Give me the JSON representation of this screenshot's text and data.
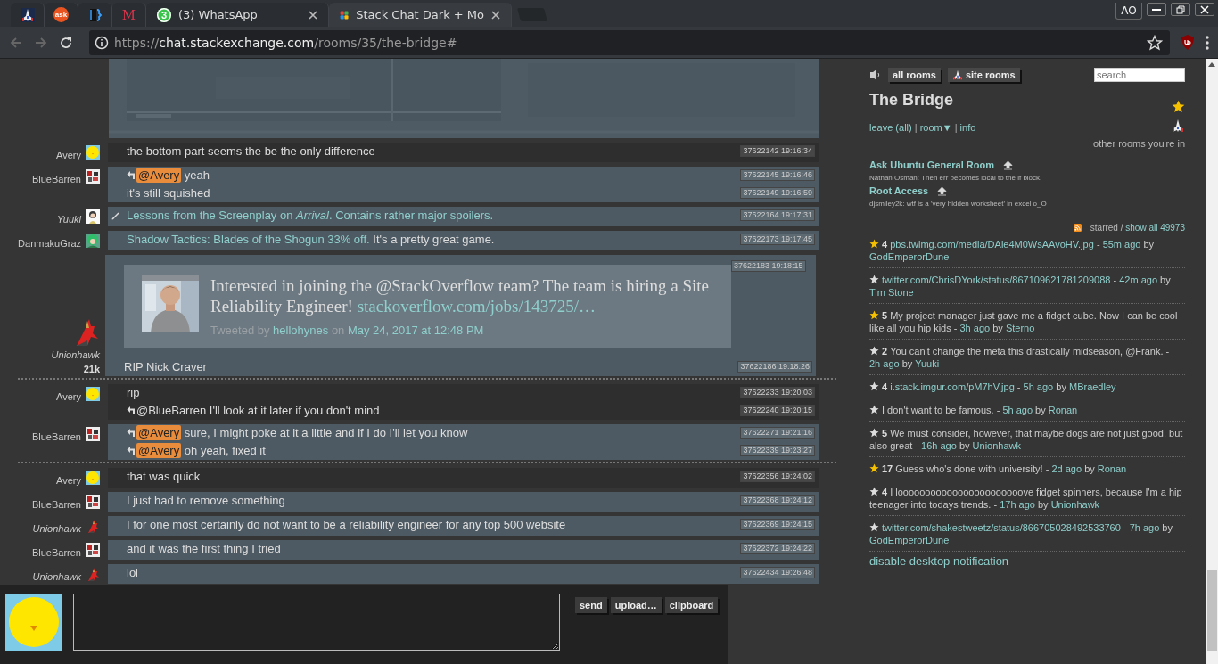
{
  "browser": {
    "tabs": [
      {
        "kind": "ship",
        "selected": false
      },
      {
        "kind": "badge",
        "label": "ask",
        "selected": false
      },
      {
        "kind": "brackets",
        "selected": false
      },
      {
        "kind": "letter",
        "label": "M",
        "selected": false
      },
      {
        "kind": "whatsapp",
        "badge": "3",
        "title": "(3) WhatsApp",
        "selected": false
      },
      {
        "kind": "squares",
        "title": "Stack Chat Dark + Mo",
        "selected": true
      }
    ],
    "profile": "AO",
    "url": [
      {
        "kind": "dim",
        "text": "https://"
      },
      {
        "kind": "host",
        "text": "chat.stackexchange.com"
      },
      {
        "kind": "dim",
        "text": "/rooms/35/the-bridge#"
      }
    ]
  },
  "chat": {
    "groups": [
      {
        "user": {
          "name": "Avery",
          "owner": false,
          "kind": "chick"
        },
        "mine": true,
        "separator_before": false,
        "messages": [
          {
            "reply": false,
            "edited": false,
            "parts": [
              {
                "kind": "text",
                "text": "the bottom part seems the be the only difference"
              }
            ],
            "meta": "37622142 19:16:34"
          }
        ]
      },
      {
        "user": {
          "name": "BlueBarren",
          "owner": false,
          "kind": "pixel"
        },
        "mine": false,
        "separator_before": false,
        "messages": [
          {
            "reply": true,
            "edited": false,
            "parts": [
              {
                "kind": "mention",
                "text": "@Avery"
              },
              {
                "kind": "text",
                "text": " yeah"
              }
            ],
            "meta": "37622145 19:16:46"
          },
          {
            "reply": false,
            "edited": false,
            "parts": [
              {
                "kind": "text",
                "text": "it's still squished"
              }
            ],
            "meta": "37622149 19:16:59"
          }
        ]
      },
      {
        "user": {
          "name": "Yuuki",
          "owner": true,
          "kind": "girl"
        },
        "mine": false,
        "separator_before": false,
        "messages": [
          {
            "reply": false,
            "edited": true,
            "parts": [
              {
                "kind": "link",
                "text": "Lessons from the Screenplay on *Arrival*. Contains rather major spoilers."
              }
            ],
            "meta": "37622164 19:17:31"
          }
        ]
      },
      {
        "user": {
          "name": "DanmakuGraz",
          "owner": false,
          "kind": "green"
        },
        "mine": false,
        "separator_before": false,
        "messages": [
          {
            "reply": false,
            "edited": false,
            "parts": [
              {
                "kind": "link",
                "text": "Shadow Tactics: Blades of the Shogun 33% off."
              },
              {
                "kind": "text",
                "text": " It's a pretty great game."
              }
            ],
            "meta": "37622173 19:17:45"
          }
        ]
      },
      {
        "user": {
          "name": "Unionhawk",
          "owner": true,
          "kind": "dragon",
          "rep": "21k"
        },
        "mine": false,
        "separator_before": false,
        "messages": [
          {
            "reply": false,
            "edited": false,
            "onebox": {
              "parts": [
                {
                  "kind": "text",
                  "text": "Interested in joining the @StackOverflow team? The team is hiring a Site Reliability Engineer! "
                },
                {
                  "kind": "link",
                  "text": "stackoverflow.com/jobs/143725/…"
                }
              ],
              "byline": [
                {
                  "kind": "text",
                  "text": "Tweeted by "
                },
                {
                  "kind": "link",
                  "text": "hellohynes"
                },
                {
                  "kind": "text",
                  "text": " on "
                },
                {
                  "kind": "link",
                  "text": "May 24, 2017 at 12:48 PM"
                }
              ]
            },
            "meta": "37622183 19:18:15"
          },
          {
            "reply": false,
            "edited": false,
            "parts": [
              {
                "kind": "text",
                "text": "RIP Nick Craver"
              }
            ],
            "meta": "37622186 19:18:26"
          }
        ]
      },
      {
        "user": {
          "name": "Avery",
          "owner": false,
          "kind": "chick"
        },
        "mine": true,
        "separator_before": true,
        "messages": [
          {
            "reply": false,
            "edited": false,
            "parts": [
              {
                "kind": "text",
                "text": "rip"
              }
            ],
            "meta": "37622233 19:20:03"
          },
          {
            "reply": true,
            "edited": false,
            "parts": [
              {
                "kind": "text",
                "text": "@BlueBarren I'll look at it later if you don't mind"
              }
            ],
            "meta": "37622240 19:20:15"
          }
        ]
      },
      {
        "user": {
          "name": "BlueBarren",
          "owner": false,
          "kind": "pixel"
        },
        "mine": false,
        "separator_before": false,
        "messages": [
          {
            "reply": true,
            "edited": false,
            "parts": [
              {
                "kind": "mention",
                "text": "@Avery"
              },
              {
                "kind": "text",
                "text": " sure, I might poke at it a little and if I do I'll let you know"
              }
            ],
            "meta": "37622271 19:21:16"
          },
          {
            "reply": true,
            "edited": false,
            "parts": [
              {
                "kind": "mention",
                "text": "@Avery"
              },
              {
                "kind": "text",
                "text": " oh yeah, fixed it"
              }
            ],
            "meta": "37622339 19:23:27"
          }
        ]
      },
      {
        "user": {
          "name": "Avery",
          "owner": false,
          "kind": "chick"
        },
        "mine": true,
        "separator_before": true,
        "messages": [
          {
            "reply": false,
            "edited": false,
            "parts": [
              {
                "kind": "text",
                "text": "that was quick"
              }
            ],
            "meta": "37622356 19:24:02"
          }
        ]
      },
      {
        "user": {
          "name": "BlueBarren",
          "owner": false,
          "kind": "pixel"
        },
        "mine": false,
        "separator_before": false,
        "messages": [
          {
            "reply": false,
            "edited": false,
            "parts": [
              {
                "kind": "text",
                "text": "I just had to remove something"
              }
            ],
            "meta": "37622368 19:24:12"
          }
        ]
      },
      {
        "user": {
          "name": "Unionhawk",
          "owner": true,
          "kind": "dragon"
        },
        "mine": false,
        "separator_before": false,
        "messages": [
          {
            "reply": false,
            "edited": false,
            "parts": [
              {
                "kind": "text",
                "text": "I for one most certainly do not want to be a reliability engineer for any top 500 website"
              }
            ],
            "meta": "37622369 19:24:15"
          }
        ]
      },
      {
        "user": {
          "name": "BlueBarren",
          "owner": false,
          "kind": "pixel"
        },
        "mine": false,
        "separator_before": false,
        "messages": [
          {
            "reply": false,
            "edited": false,
            "parts": [
              {
                "kind": "text",
                "text": "and it was the first thing I tried"
              }
            ],
            "meta": "37622372 19:24:22"
          }
        ]
      },
      {
        "user": {
          "name": "Unionhawk",
          "owner": true,
          "kind": "dragon"
        },
        "mine": false,
        "separator_before": false,
        "messages": [
          {
            "reply": false,
            "edited": false,
            "parts": [
              {
                "kind": "text",
                "text": "lol"
              }
            ],
            "meta": "37622434 19:26:48"
          }
        ]
      }
    ],
    "input": {
      "buttons": [
        "send",
        "upload…",
        "clipboard"
      ]
    }
  },
  "sidebar": {
    "buttons": [
      {
        "kind": "plain",
        "label": "all rooms"
      },
      {
        "kind": "site",
        "label": "site rooms"
      }
    ],
    "search": {
      "placeholder": "search"
    },
    "room_title": "The Bridge",
    "room_starred": true,
    "room_links": [
      {
        "kind": "link",
        "text": "leave (all)"
      },
      {
        "kind": "text",
        "text": " | "
      },
      {
        "kind": "link",
        "text": "room▼"
      },
      {
        "kind": "text",
        "text": " | "
      },
      {
        "kind": "link",
        "text": "info"
      }
    ],
    "other_rooms_label": "other rooms you're in",
    "other_rooms": [
      {
        "name": "Ask Ubuntu General Room",
        "last_message": "Nathan Osman: Then err becomes local to the if block."
      },
      {
        "name": "Root Access",
        "last_message": "djsmiley2k: wtf is a 'very hidden worksheet' in excel o_O"
      }
    ],
    "starred_label": "starred / ",
    "show_all": "show all 49973",
    "starred": [
      {
        "starred": true,
        "parts": [
          {
            "kind": "count",
            "text": "4 "
          },
          {
            "kind": "link",
            "text": "pbs.twimg.com/media/DAle4M0WsAAvoHV.jpg"
          },
          {
            "kind": "text",
            "text": " - "
          },
          {
            "kind": "link",
            "text": "55m ago"
          },
          {
            "kind": "text",
            "text": " by "
          },
          {
            "kind": "link",
            "text": "GodEmperorDune"
          }
        ]
      },
      {
        "starred": false,
        "parts": [
          {
            "kind": "link",
            "text": "twitter.com/ChrisDYork/status/867109621781209088"
          },
          {
            "kind": "text",
            "text": " - "
          },
          {
            "kind": "link",
            "text": "42m ago"
          },
          {
            "kind": "text",
            "text": " by "
          },
          {
            "kind": "link",
            "text": "Tim Stone"
          }
        ]
      },
      {
        "starred": true,
        "parts": [
          {
            "kind": "count",
            "text": "5 "
          },
          {
            "kind": "text",
            "text": "My project manager just gave me a fidget cube. Now I can be cool like all you hip kids - "
          },
          {
            "kind": "link",
            "text": "3h ago"
          },
          {
            "kind": "text",
            "text": " by "
          },
          {
            "kind": "link",
            "text": "Sterno"
          }
        ]
      },
      {
        "starred": false,
        "parts": [
          {
            "kind": "count",
            "text": "2 "
          },
          {
            "kind": "text",
            "text": "You can't change the meta this drastically midseason, @Frank. - "
          },
          {
            "kind": "link",
            "text": "2h ago"
          },
          {
            "kind": "text",
            "text": " by "
          },
          {
            "kind": "link",
            "text": "Yuuki"
          }
        ]
      },
      {
        "starred": false,
        "parts": [
          {
            "kind": "count",
            "text": "4 "
          },
          {
            "kind": "link",
            "text": "i.stack.imgur.com/pM7hV.jpg"
          },
          {
            "kind": "text",
            "text": " - "
          },
          {
            "kind": "link",
            "text": "5h ago"
          },
          {
            "kind": "text",
            "text": " by "
          },
          {
            "kind": "link",
            "text": "MBraedley"
          }
        ]
      },
      {
        "starred": false,
        "parts": [
          {
            "kind": "text",
            "text": "I don't want to be famous. - "
          },
          {
            "kind": "link",
            "text": "5h ago"
          },
          {
            "kind": "text",
            "text": " by "
          },
          {
            "kind": "link",
            "text": "Ronan"
          }
        ]
      },
      {
        "starred": false,
        "parts": [
          {
            "kind": "count",
            "text": "5 "
          },
          {
            "kind": "text",
            "text": "We must consider, however, that maybe dogs are not just good, but also great - "
          },
          {
            "kind": "link",
            "text": "16h ago"
          },
          {
            "kind": "text",
            "text": " by "
          },
          {
            "kind": "link",
            "text": "Unionhawk"
          }
        ]
      },
      {
        "starred": true,
        "parts": [
          {
            "kind": "count",
            "text": "17 "
          },
          {
            "kind": "text",
            "text": "Guess who's done with university! - "
          },
          {
            "kind": "link",
            "text": "2d ago"
          },
          {
            "kind": "text",
            "text": " by "
          },
          {
            "kind": "link",
            "text": "Ronan"
          }
        ]
      },
      {
        "starred": false,
        "parts": [
          {
            "kind": "count",
            "text": "4 "
          },
          {
            "kind": "text",
            "text": "I looooooooooooooooooooooove fidget spinners, because I'm a hip teenager into todays trends. - "
          },
          {
            "kind": "link",
            "text": "17h ago"
          },
          {
            "kind": "text",
            "text": " by "
          },
          {
            "kind": "link",
            "text": "Unionhawk"
          }
        ]
      },
      {
        "starred": false,
        "parts": [
          {
            "kind": "link",
            "text": "twitter.com/shakestweetz/status/866705028492533760"
          },
          {
            "kind": "text",
            "text": " - "
          },
          {
            "kind": "link",
            "text": "7h ago"
          },
          {
            "kind": "text",
            "text": " by "
          },
          {
            "kind": "link",
            "text": "GodEmperorDune"
          }
        ]
      }
    ],
    "notification_link": "disable desktop notification"
  }
}
